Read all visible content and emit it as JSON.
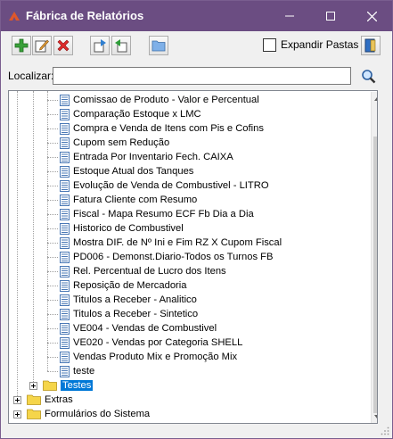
{
  "window": {
    "title": "Fábrica de Relatórios"
  },
  "toolbar": {
    "buttons": [
      "add-icon",
      "edit-icon",
      "delete-icon",
      "import-icon",
      "export-icon",
      "open-folder-icon"
    ],
    "expand_label": "Expandir Pastas",
    "exit_icon": "exit-door-icon"
  },
  "search": {
    "label": "Localizar:",
    "value": "",
    "placeholder": ""
  },
  "tree": {
    "reports": [
      "Comissao de Produto - Valor e Percentual",
      "Comparação Estoque x LMC",
      "Compra e Venda  de Itens com Pis e Cofins",
      "Cupom sem Redução",
      "Entrada Por Inventario Fech. CAIXA",
      "Estoque Atual dos Tanques",
      "Evolução de Venda de Combustivel - LITRO",
      "Fatura Cliente com Resumo",
      "Fiscal - Mapa Resumo ECF Fb Dia a Dia",
      "Historico de Combustivel",
      "Mostra DIF. de Nº Ini e Fim RZ X Cupom Fiscal",
      "PD006 - Demonst.Diario-Todos os Turnos FB",
      "Rel. Percentual de Lucro dos Itens",
      "Reposição de Mercadoria",
      "Titulos a Receber - Analitico",
      "Titulos a Receber - Sintetico",
      "VE004 - Vendas de Combustivel",
      "VE020 - Vendas por Categoria SHELL",
      "Vendas Produto Mix e Promoção Mix",
      "teste"
    ],
    "selected_folder": "Testes",
    "root_folders": [
      "Extras",
      "Formulários do Sistema"
    ]
  }
}
